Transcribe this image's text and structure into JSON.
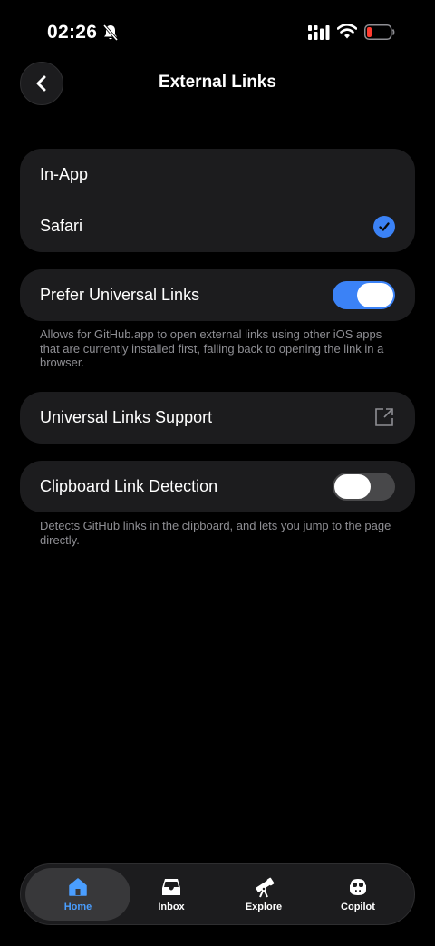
{
  "status_bar": {
    "time": "02:26",
    "icons": [
      "bell-slash-icon",
      "cellular-signal-icon",
      "wifi-icon",
      "battery-low-icon"
    ],
    "battery_color": "#ff3b30"
  },
  "header": {
    "title": "External Links",
    "back_icon": "chevron-left-icon"
  },
  "open_in": {
    "options": [
      {
        "label": "In-App",
        "selected": false
      },
      {
        "label": "Safari",
        "selected": true
      }
    ]
  },
  "universal_links": {
    "label": "Prefer Universal Links",
    "enabled": true,
    "description": "Allows for GitHub.app to open external links using other iOS apps that are currently installed first, falling back to opening the link in a browser."
  },
  "support": {
    "label": "Universal Links Support",
    "icon": "external-link-icon"
  },
  "clipboard": {
    "label": "Clipboard Link Detection",
    "enabled": false,
    "description": "Detects GitHub links in the clipboard, and lets you jump to the page directly."
  },
  "tabs": [
    {
      "label": "Home",
      "icon": "house-icon",
      "active": true
    },
    {
      "label": "Inbox",
      "icon": "inbox-icon",
      "active": false
    },
    {
      "label": "Explore",
      "icon": "telescope-icon",
      "active": false
    },
    {
      "label": "Copilot",
      "icon": "copilot-icon",
      "active": false
    }
  ],
  "colors": {
    "background": "#000000",
    "card": "#1c1c1e",
    "accent": "#3b82f6",
    "active_tab_label": "#4a9eff",
    "secondary_text": "#8e8e93"
  }
}
